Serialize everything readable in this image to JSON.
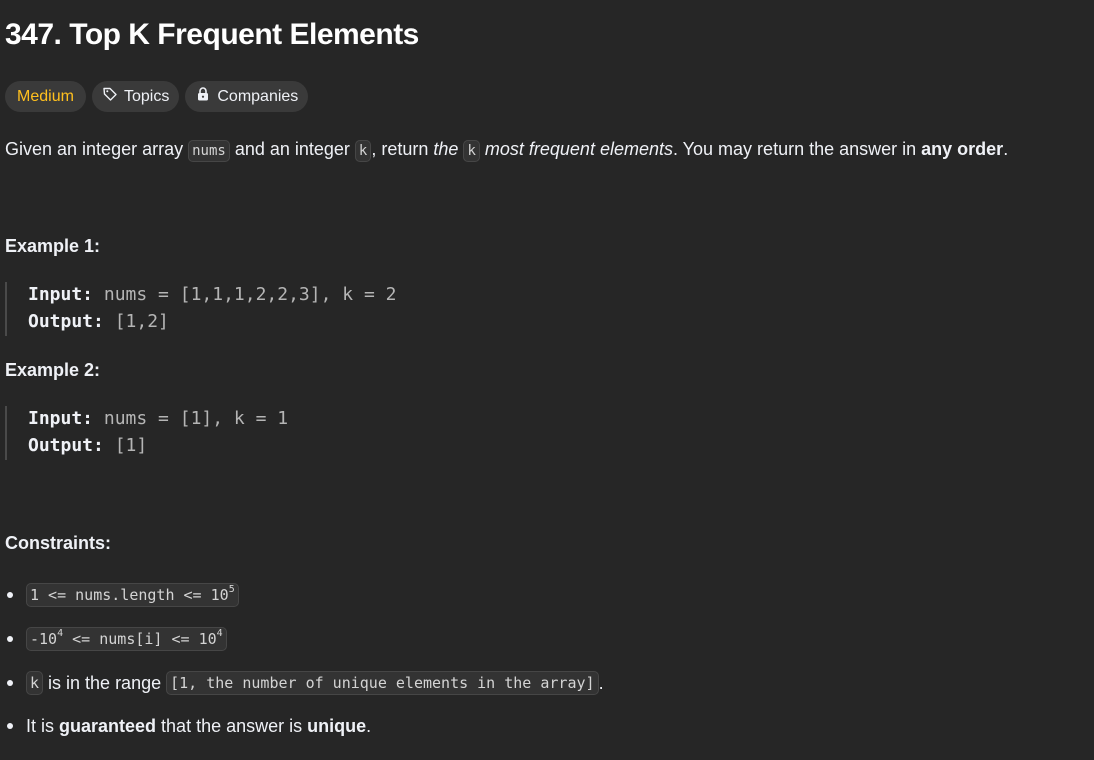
{
  "title": "347. Top K Frequent Elements",
  "tags": {
    "difficulty": "Medium",
    "topics": "Topics",
    "companies": "Companies"
  },
  "description": {
    "p1": "Given an integer array ",
    "c1": "nums",
    "p2": " and an integer ",
    "c2": "k",
    "p3": ", return ",
    "i1": "the",
    "p4": " ",
    "c3": "k",
    "p5": " ",
    "i2": "most frequent elements",
    "p6": ". You may return the answer in ",
    "b1": "any order",
    "p7": "."
  },
  "example1": {
    "heading": "Example 1:",
    "input_label": "Input:",
    "input_value": " nums = [1,1,1,2,2,3], k = 2",
    "output_label": "Output:",
    "output_value": " [1,2]"
  },
  "example2": {
    "heading": "Example 2:",
    "input_label": "Input:",
    "input_value": " nums = [1], k = 1",
    "output_label": "Output:",
    "output_value": " [1]"
  },
  "constraints": {
    "heading": "Constraints:",
    "c1": {
      "code": "1 <= nums.length <= 10",
      "sup": "5"
    },
    "c2": {
      "code_a": "-10",
      "sup_a": "4",
      "code_b": " <= nums[i] <= 10",
      "sup_b": "4"
    },
    "c3": {
      "code_k": "k",
      "text": " is in the range ",
      "code_range": "[1, the number of unique elements in the array]",
      "end": "."
    },
    "c4": {
      "t1": "It is ",
      "b1": "guaranteed",
      "t2": " that the answer is ",
      "b2": "unique",
      "t3": "."
    }
  }
}
